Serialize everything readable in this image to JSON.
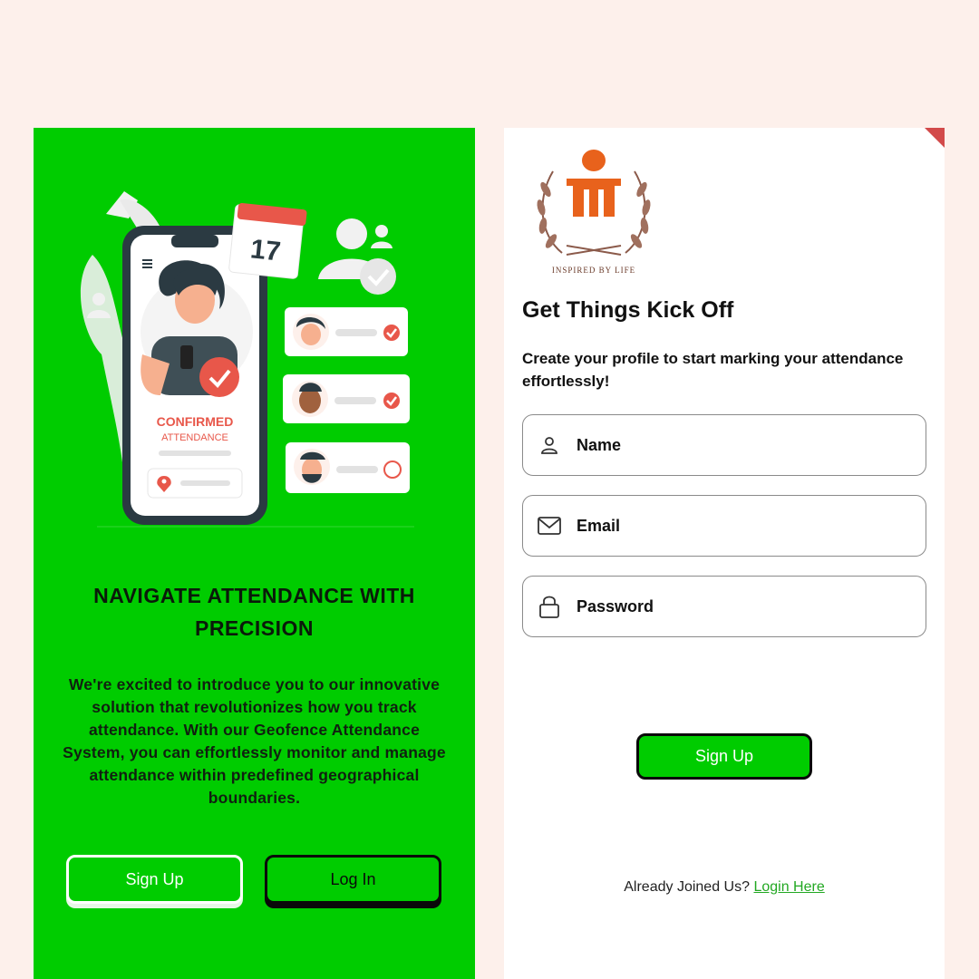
{
  "left_panel": {
    "illustration": {
      "calendar_day": "17",
      "confirmed_label": "CONFIRMED",
      "attendance_label": "ATTENDANCE"
    },
    "headline": "NAVIGATE ATTENDANCE WITH\nPRECISION",
    "intro": "We're excited to introduce you to our innovative solution that revolutionizes how you track attendance. With our Geofence Attendance System, you can effortlessly monitor and manage attendance within predefined geographical boundaries.",
    "signup_label": "Sign Up",
    "login_label": "Log In"
  },
  "right_panel": {
    "logo_text": "INSPIRED BY LIFE",
    "title": "Get Things Kick Off",
    "subtitle": "Create your profile to start marking your attendance effortlessly!",
    "fields": [
      {
        "label": "Name",
        "icon": "user-icon"
      },
      {
        "label": "Email",
        "icon": "mail-icon"
      },
      {
        "label": "Password",
        "icon": "lock-icon"
      }
    ],
    "signup_label": "Sign Up",
    "footer_text": "Already Joined Us?",
    "footer_link": "Login Here"
  },
  "colors": {
    "brand_green": "#00cc00",
    "background": "#fdf0eb",
    "accent_red": "#e8574a"
  }
}
